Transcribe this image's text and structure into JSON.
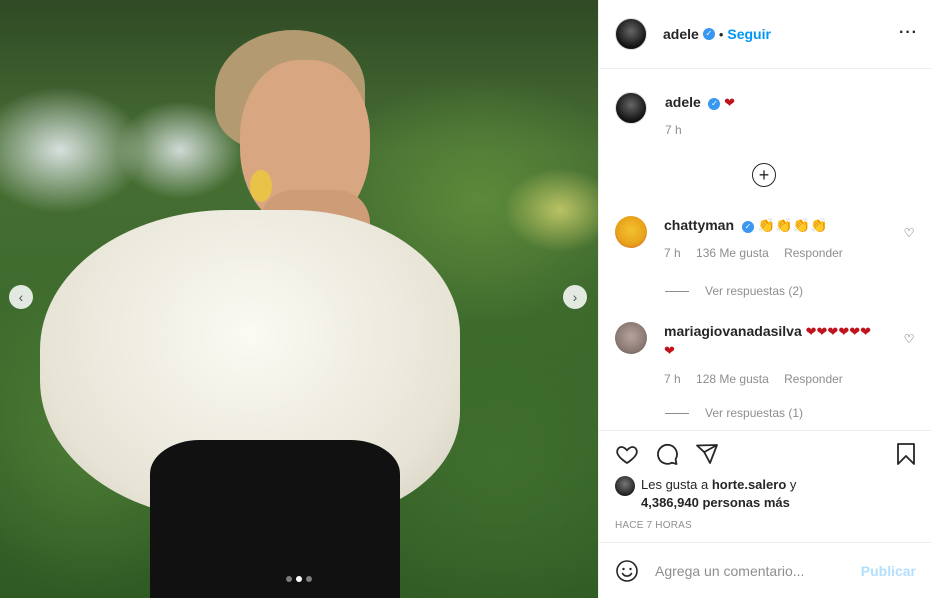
{
  "header": {
    "username": "adele",
    "separator": "•",
    "follow_label": "Seguir",
    "more_icon": "more-options-icon"
  },
  "caption": {
    "username": "adele",
    "text": "❤",
    "time": "7 h"
  },
  "comments": [
    {
      "username": "chattyman",
      "text": "👏👏👏👏",
      "time": "7 h",
      "likes": "136 Me gusta",
      "reply_label": "Responder",
      "view_replies": "Ver respuestas (2)",
      "avatar_color": "#f2c230"
    },
    {
      "username": "mariagiovanadasilva",
      "text": "❤❤❤❤❤❤❤",
      "time": "7 h",
      "likes": "128 Me gusta",
      "reply_label": "Responder",
      "view_replies": "Ver respuestas (1)",
      "avatar_color": "#9c8a86"
    }
  ],
  "actions": {
    "icons": [
      "like-icon",
      "comment-icon",
      "share-icon",
      "bookmark-icon"
    ]
  },
  "likes": {
    "prefix": "Les gusta a",
    "first_user": "horte.salero",
    "connector": "y",
    "count": "4,386,940 personas más"
  },
  "timestamp": "HACE 7 HORAS",
  "composer": {
    "placeholder": "Agrega un comentario...",
    "publish_label": "Publicar"
  },
  "carousel": {
    "total": 3,
    "active": 2
  },
  "colors": {
    "accent": "#0095f6",
    "verified": "#3897f0",
    "heart": "#c0121b",
    "publish_disabled": "#b2dffc"
  }
}
